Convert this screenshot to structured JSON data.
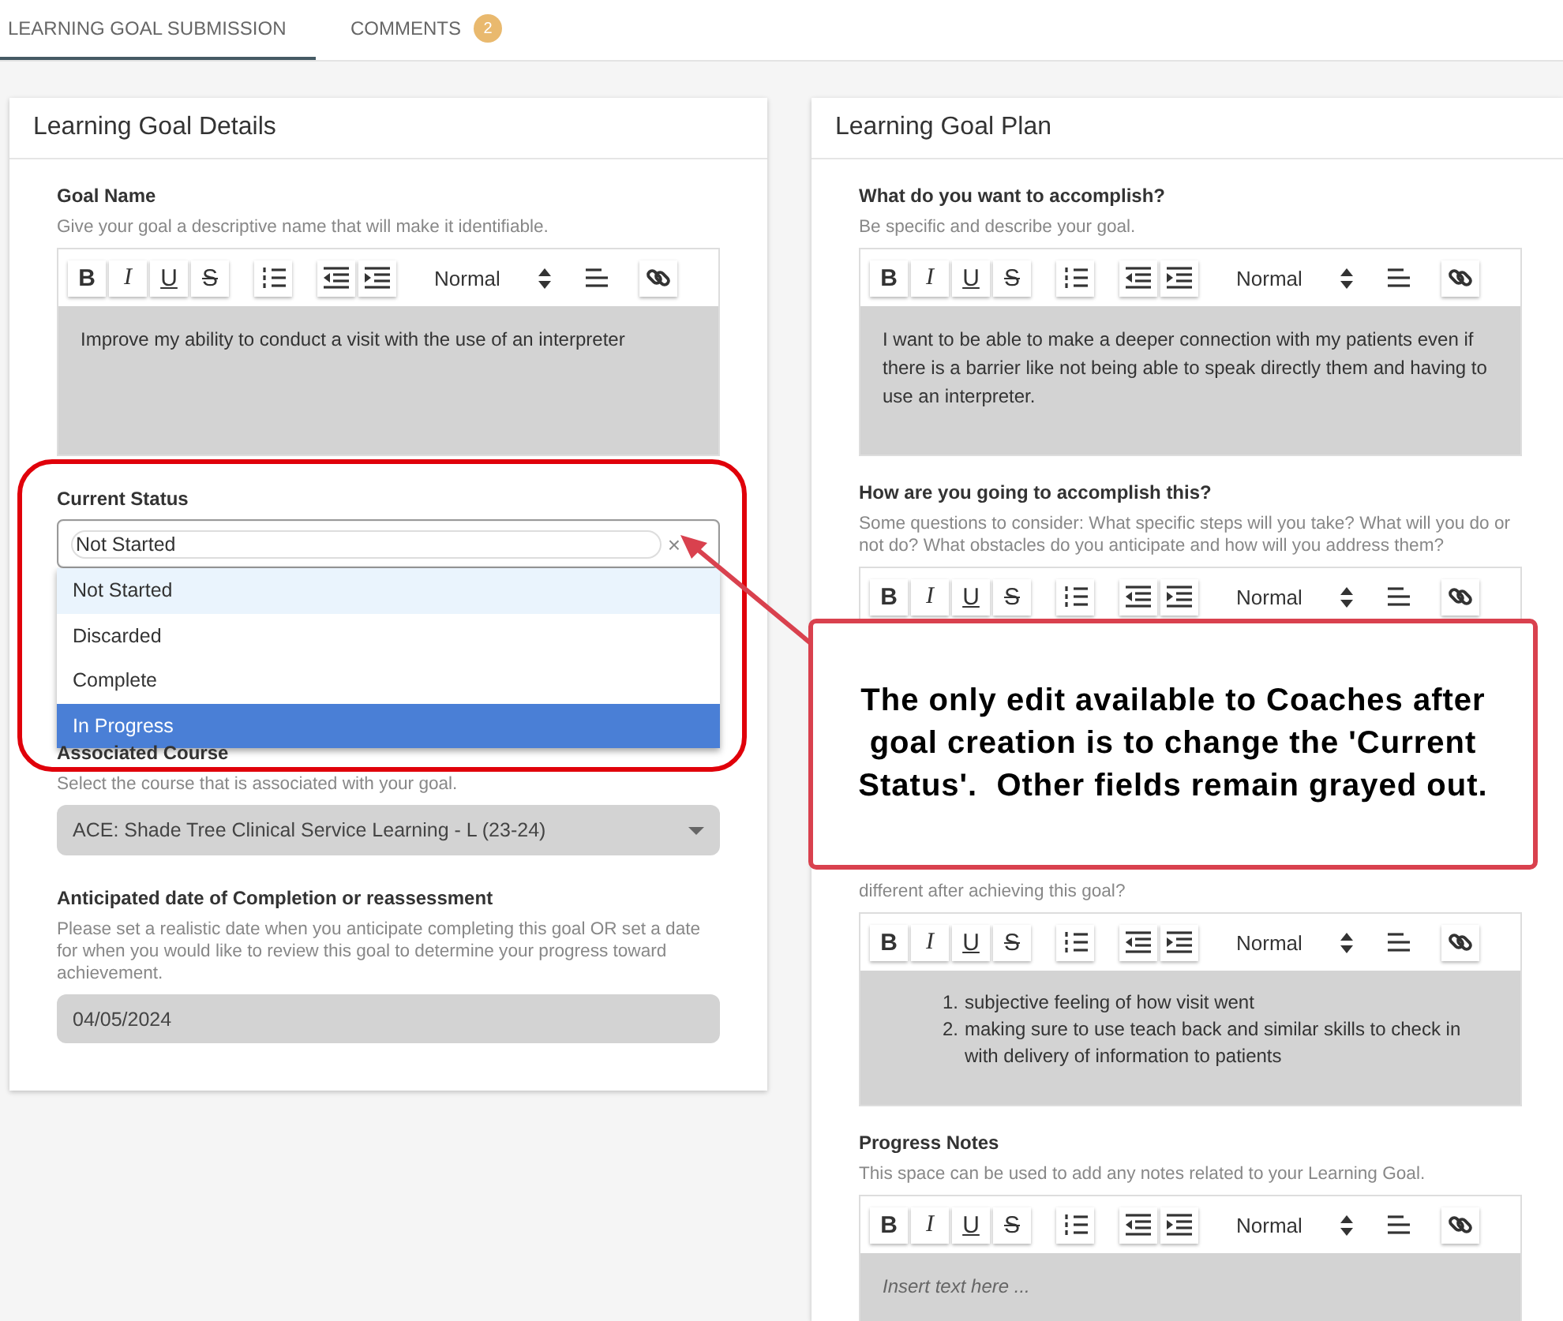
{
  "tabs": [
    {
      "label": "LEARNING GOAL SUBMISSION",
      "selected": true
    },
    {
      "label": "COMMENTS",
      "selected": false,
      "badge": "2"
    }
  ],
  "panels": [
    {
      "title": "Learning Goal Details",
      "fields": [
        {
          "kind": "editor",
          "label": "Goal Name",
          "hint": "Give your goal a descriptive name that will make it identifiable.",
          "toolbar": {
            "marks": [
              "B",
              "I",
              "U",
              "S"
            ],
            "format": "Normal"
          },
          "content": {
            "kind": "paragraph",
            "text": "Improve my ability to conduct a visit with the use of an interpreter"
          }
        },
        {
          "kind": "dropdown",
          "label": "Current Status",
          "value": "Not Started",
          "clear": "×",
          "options": [
            {
              "label": "Not Started",
              "selected": true,
              "highlighted": false
            },
            {
              "label": "Discarded",
              "selected": false,
              "highlighted": false
            },
            {
              "label": "Complete",
              "selected": false,
              "highlighted": false
            },
            {
              "label": "In Progress",
              "selected": false,
              "highlighted": true
            }
          ]
        },
        {
          "kind": "select",
          "label": "Associated Course",
          "hint": "Select the course that is associated with your goal.",
          "value": "ACE: Shade Tree Clinical Service Learning - L (23-24)"
        },
        {
          "kind": "date",
          "label": "Anticipated date of Completion or reassessment",
          "hint": "Please set a realistic date when you anticipate completing this goal OR set a date for when you would like to review this goal to determine your progress toward achievement.",
          "value": "04/05/2024"
        }
      ]
    },
    {
      "title": "Learning Goal Plan",
      "fields": [
        {
          "kind": "editor",
          "label": "What do you want to accomplish?",
          "hint": "Be specific and describe your goal.",
          "toolbar": {
            "marks": [
              "B",
              "I",
              "U",
              "S"
            ],
            "format": "Normal"
          },
          "content": {
            "kind": "paragraph",
            "text": "I want to be able to make a deeper connection with my patients even if there is a barrier like not being able to speak directly them and having to use an interpreter."
          }
        },
        {
          "kind": "editor",
          "label": "How are you going to accomplish this?",
          "hint": "Some questions to consider: What specific steps will you take? What will you do or not do? What obstacles do you anticipate and how will you address them?",
          "toolbar": {
            "marks": [
              "B",
              "I",
              "U",
              "S"
            ],
            "format": "Normal"
          }
        },
        {
          "kind": "editor",
          "hint": "different after achieving this goal?",
          "toolbar": {
            "marks": [
              "B",
              "I",
              "U",
              "S"
            ],
            "format": "Normal"
          },
          "content": {
            "kind": "list",
            "items": [
              {
                "marker": "1.",
                "text": "subjective feeling of how visit went"
              },
              {
                "marker": "2.",
                "text": "making sure to use teach back and similar skills to check in with delivery of information to patients"
              }
            ]
          }
        },
        {
          "kind": "editor",
          "label": "Progress Notes",
          "hint": "This space can be used to add any notes related to your Learning Goal.",
          "toolbar": {
            "marks": [
              "B",
              "I",
              "U",
              "S"
            ],
            "format": "Normal"
          },
          "content": {
            "kind": "placeholder",
            "text": "Insert text here ..."
          }
        }
      ]
    }
  ],
  "annotation": {
    "text": "The only edit available to Coaches after goal creation is to change the 'Current Status'.  Other fields remain grayed out."
  }
}
